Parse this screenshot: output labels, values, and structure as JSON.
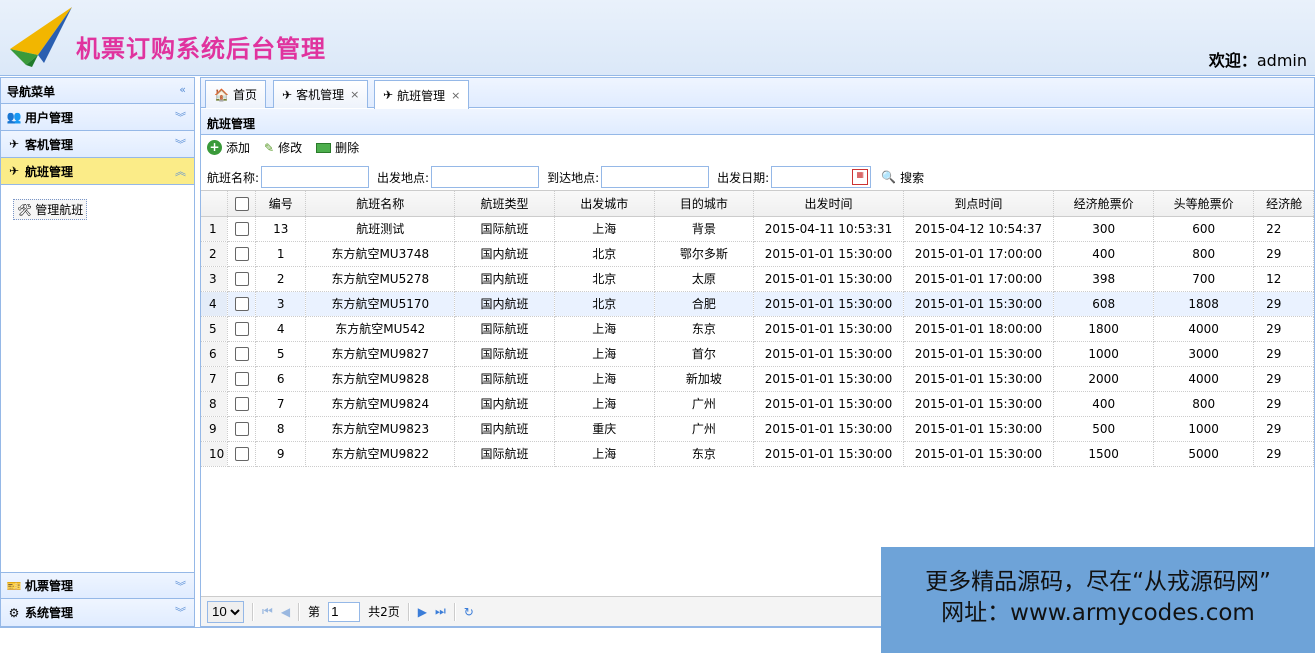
{
  "app": {
    "title": "机票订购系统后台管理",
    "welcome_label": "欢迎：",
    "user": "admin"
  },
  "sidebar": {
    "header": "导航菜单",
    "items": [
      {
        "label": "用户管理",
        "icon": "users-icon"
      },
      {
        "label": "客机管理",
        "icon": "airplane-icon"
      },
      {
        "label": "航班管理",
        "icon": "flight-icon",
        "active": true
      }
    ],
    "sub_items": [
      {
        "label": "管理航班",
        "icon": "tools-icon"
      }
    ],
    "bottom_items": [
      {
        "label": "机票管理",
        "icon": "ticket-icon"
      },
      {
        "label": "系统管理",
        "icon": "gear-icon"
      }
    ]
  },
  "tabs": [
    {
      "label": "首页",
      "icon": "home-icon",
      "closable": false
    },
    {
      "label": "客机管理",
      "icon": "airplane-icon",
      "closable": true
    },
    {
      "label": "航班管理",
      "icon": "flight-icon",
      "closable": true,
      "selected": true
    }
  ],
  "panel": {
    "title": "航班管理"
  },
  "toolbar": {
    "add_label": "添加",
    "edit_label": "修改",
    "delete_label": "删除"
  },
  "search": {
    "flight_name_label": "航班名称:",
    "from_label": "出发地点:",
    "to_label": "到达地点:",
    "date_label": "出发日期:",
    "search_label": "搜索"
  },
  "grid": {
    "columns": [
      "编号",
      "航班名称",
      "航班类型",
      "出发城市",
      "目的城市",
      "出发时间",
      "到点时间",
      "经济舱票价",
      "头等舱票价",
      "经济舱"
    ],
    "rows": [
      [
        "13",
        "航班测试",
        "国际航班",
        "上海",
        "背景",
        "2015-04-11 10:53:31",
        "2015-04-12 10:54:37",
        "300",
        "600",
        "22"
      ],
      [
        "1",
        "东方航空MU3748",
        "国内航班",
        "北京",
        "鄂尔多斯",
        "2015-01-01 15:30:00",
        "2015-01-01 17:00:00",
        "400",
        "800",
        "29"
      ],
      [
        "2",
        "东方航空MU5278",
        "国内航班",
        "北京",
        "太原",
        "2015-01-01 15:30:00",
        "2015-01-01 17:00:00",
        "398",
        "700",
        "12"
      ],
      [
        "3",
        "东方航空MU5170",
        "国内航班",
        "北京",
        "合肥",
        "2015-01-01 15:30:00",
        "2015-01-01 15:30:00",
        "608",
        "1808",
        "29"
      ],
      [
        "4",
        "东方航空MU542",
        "国际航班",
        "上海",
        "东京",
        "2015-01-01 15:30:00",
        "2015-01-01 18:00:00",
        "1800",
        "4000",
        "29"
      ],
      [
        "5",
        "东方航空MU9827",
        "国际航班",
        "上海",
        "首尔",
        "2015-01-01 15:30:00",
        "2015-01-01 15:30:00",
        "1000",
        "3000",
        "29"
      ],
      [
        "6",
        "东方航空MU9828",
        "国际航班",
        "上海",
        "新加坡",
        "2015-01-01 15:30:00",
        "2015-01-01 15:30:00",
        "2000",
        "4000",
        "29"
      ],
      [
        "7",
        "东方航空MU9824",
        "国内航班",
        "上海",
        "广州",
        "2015-01-01 15:30:00",
        "2015-01-01 15:30:00",
        "400",
        "800",
        "29"
      ],
      [
        "8",
        "东方航空MU9823",
        "国内航班",
        "重庆",
        "广州",
        "2015-01-01 15:30:00",
        "2015-01-01 15:30:00",
        "500",
        "1000",
        "29"
      ],
      [
        "9",
        "东方航空MU9822",
        "国际航班",
        "上海",
        "东京",
        "2015-01-01 15:30:00",
        "2015-01-01 15:30:00",
        "1500",
        "5000",
        "29"
      ]
    ],
    "highlighted_row": 3
  },
  "pager": {
    "page_size": "10",
    "page_prefix": "第",
    "current_page": "1",
    "page_total": "共2页"
  },
  "watermark": {
    "line1": "更多精品源码，尽在“从戎源码网”",
    "line2": "网址：www.armycodes.com"
  },
  "colors": {
    "border": "#95b8e7",
    "active_menu": "#fbec88",
    "title_accent": "#e0339e",
    "watermark_bg": "#6ea3d8"
  }
}
